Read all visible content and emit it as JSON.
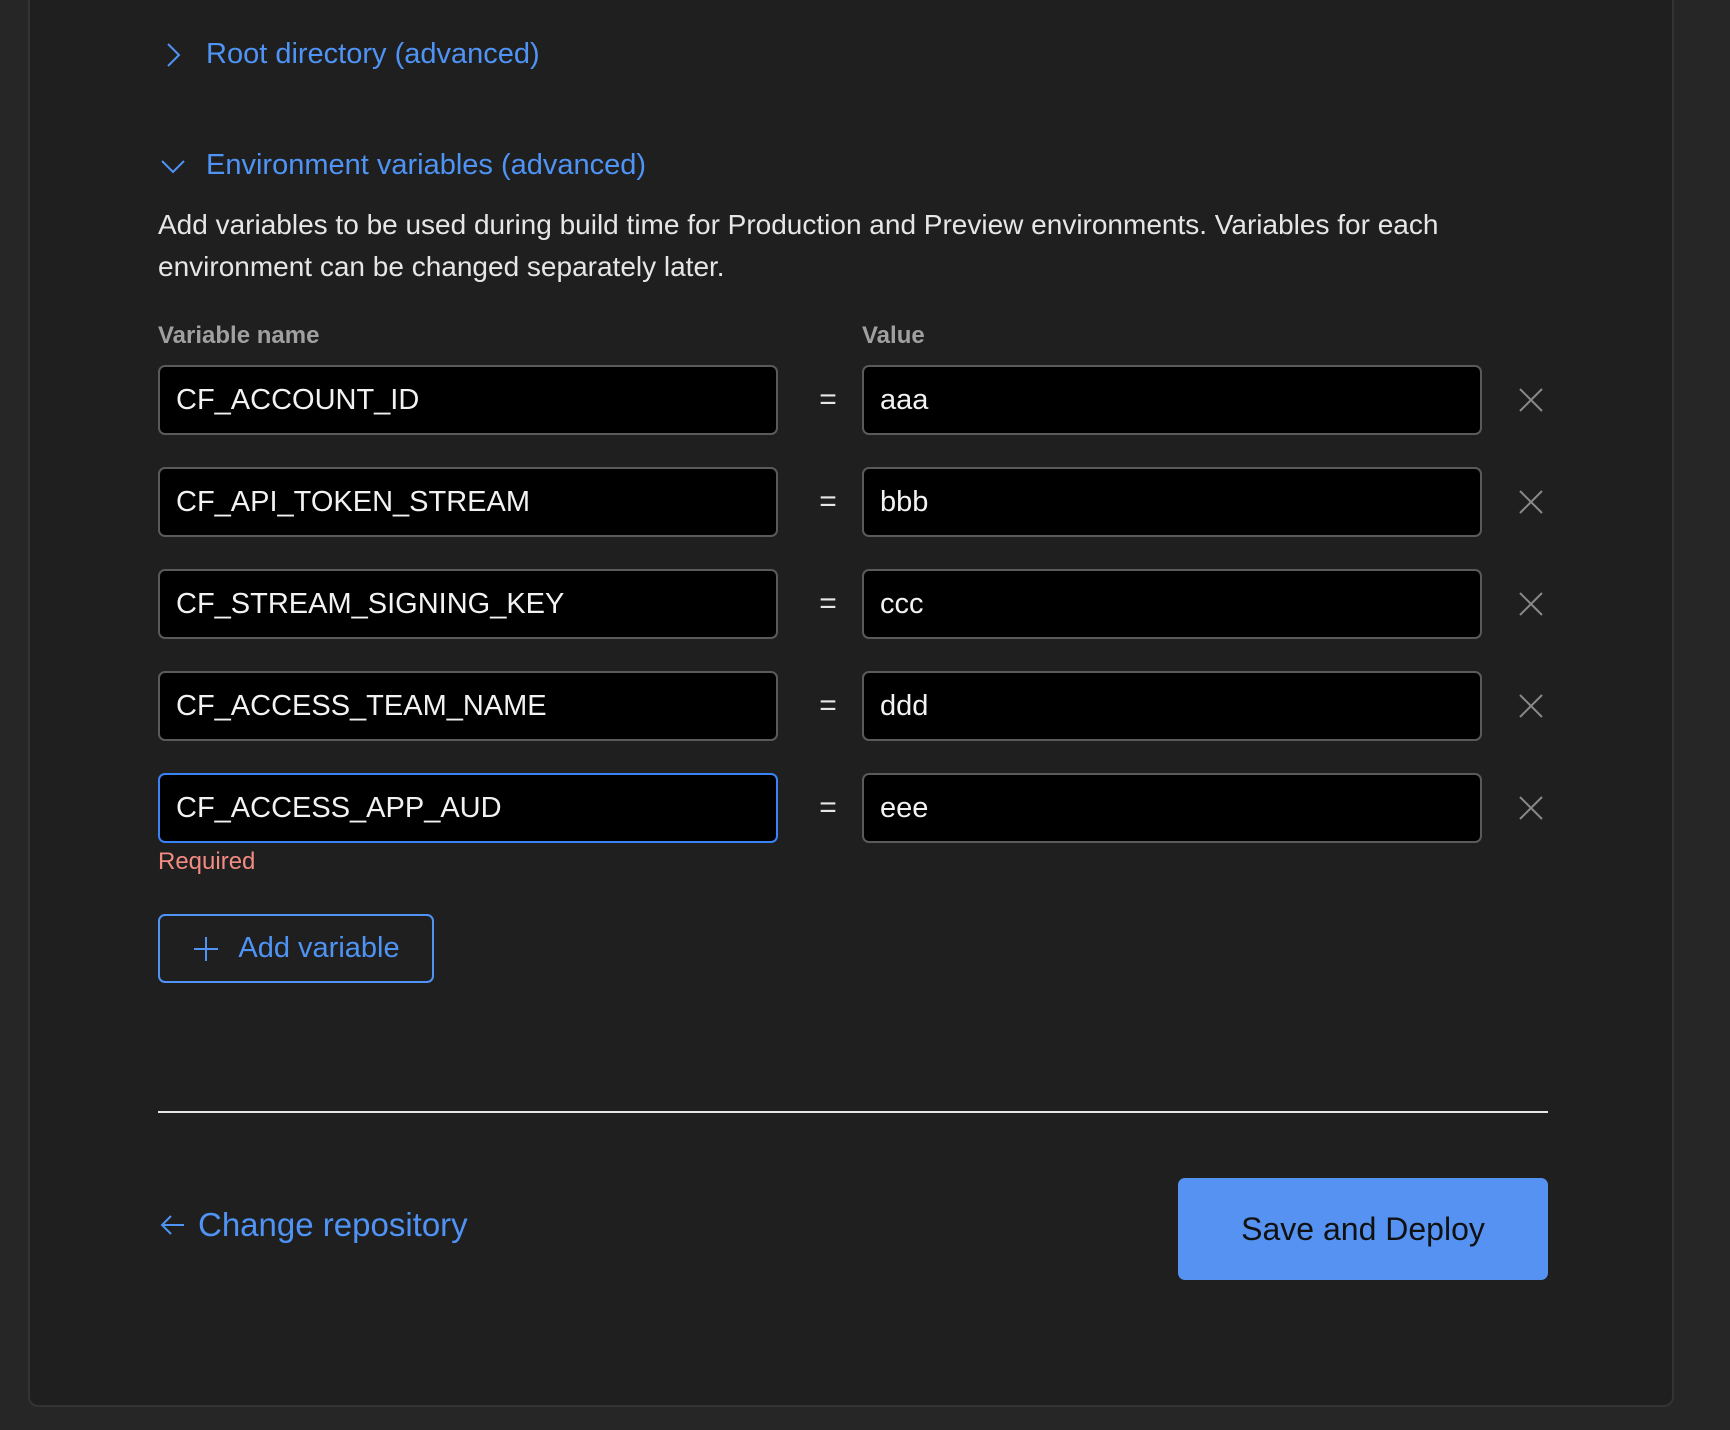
{
  "sections": {
    "root_directory": {
      "label": "Root directory (advanced)",
      "expanded": false
    },
    "environment_variables": {
      "label": "Environment variables (advanced)",
      "expanded": true,
      "description": "Add variables to be used during build time for Production and Preview environments. Variables for each environment can be changed separately later."
    }
  },
  "columns": {
    "name": "Variable name",
    "value": "Value"
  },
  "equals_sign": "=",
  "variables": [
    {
      "name": "CF_ACCOUNT_ID",
      "value": "aaa"
    },
    {
      "name": "CF_API_TOKEN_STREAM",
      "value": "bbb"
    },
    {
      "name": "CF_STREAM_SIGNING_KEY",
      "value": "ccc"
    },
    {
      "name": "CF_ACCESS_TEAM_NAME",
      "value": "ddd"
    },
    {
      "name": "CF_ACCESS_APP_AUD",
      "value": "eee"
    }
  ],
  "validation": {
    "error": "Required"
  },
  "actions": {
    "add_variable": "Add variable",
    "change_repository": "Change repository",
    "save_and_deploy": "Save and Deploy"
  },
  "colors": {
    "accent": "#4f93f4",
    "primary_button": "#5592f2",
    "error": "#f28b82",
    "background": "#1f1f20",
    "focus_border": "#3b82f6"
  }
}
